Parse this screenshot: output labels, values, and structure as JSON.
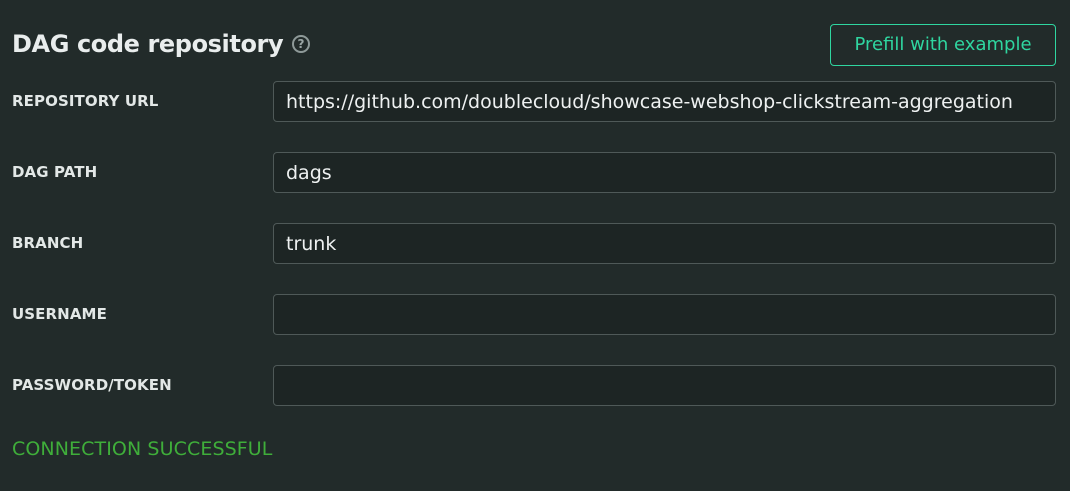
{
  "header": {
    "title": "DAG code repository",
    "help_icon": "question-circle-icon",
    "help_glyph": "?",
    "prefill_label": "Prefill with example",
    "accent_color": "#2fd6a0"
  },
  "fields": [
    {
      "label": "REPOSITORY URL",
      "value": "https://github.com/doublecloud/showcase-webshop-clickstream-aggregation",
      "placeholder": ""
    },
    {
      "label": "DAG PATH",
      "value": "dags",
      "placeholder": ""
    },
    {
      "label": "BRANCH",
      "value": "trunk",
      "placeholder": ""
    },
    {
      "label": "USERNAME",
      "value": "",
      "placeholder": ""
    },
    {
      "label": "PASSWORD/TOKEN",
      "value": "",
      "placeholder": ""
    }
  ],
  "status": {
    "text": "CONNECTION SUCCESSFUL",
    "color": "#3fae3a"
  }
}
